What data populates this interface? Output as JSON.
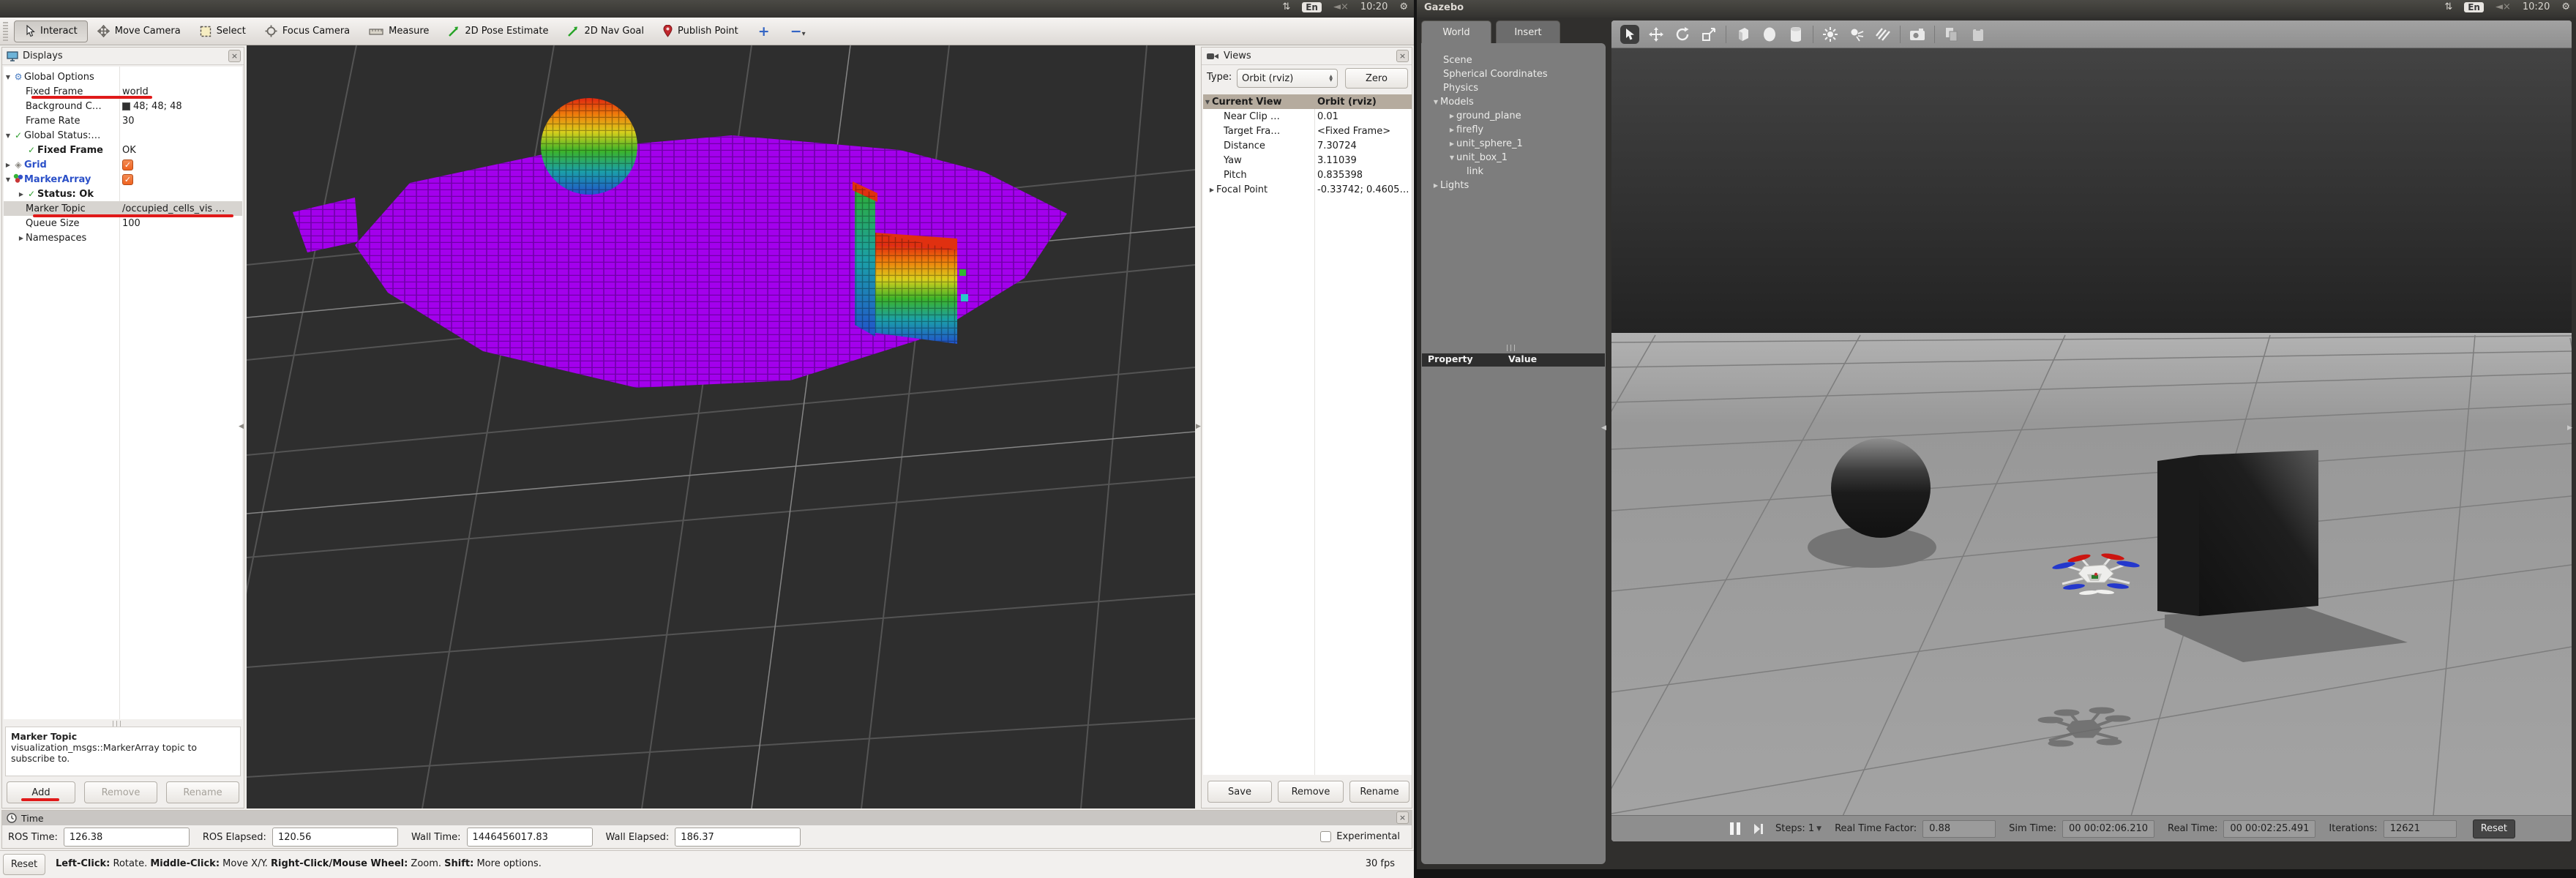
{
  "colors": {
    "annotation": "#e01a1a",
    "rviz_bg": "#2e2e2e",
    "octomap_floor": "#a300ec",
    "checkbox_checked": "#ef6321",
    "display_enabled": "#2b50c8",
    "view_header": "#b5ab9e"
  },
  "indicators": {
    "keyboard": "En",
    "clock": "10:20",
    "mute": "×"
  },
  "rviz": {
    "toolbar": {
      "tools": [
        {
          "label": "Interact"
        },
        {
          "label": "Move Camera"
        },
        {
          "label": "Select"
        },
        {
          "label": "Focus Camera"
        },
        {
          "label": "Measure"
        },
        {
          "label": "2D Pose Estimate"
        },
        {
          "label": "2D Nav Goal"
        },
        {
          "label": "Publish Point"
        }
      ],
      "plus": "+",
      "minus": "−",
      "minus_arrow": "▾"
    },
    "displays": {
      "title": "Displays",
      "rows": [
        {
          "exp": "▼",
          "label": "Global Options",
          "value": ""
        },
        {
          "exp": "",
          "label": "Fixed Frame",
          "value": "world"
        },
        {
          "exp": "",
          "label": "Background C…",
          "value": "48; 48; 48"
        },
        {
          "exp": "",
          "label": "Frame Rate",
          "value": "30"
        },
        {
          "exp": "▼",
          "label": "Global Status:…",
          "value": ""
        },
        {
          "exp": "",
          "label": "Fixed Frame",
          "value": "OK"
        },
        {
          "exp": "▶",
          "label": "Grid",
          "value": ""
        },
        {
          "exp": "▼",
          "label": "MarkerArray",
          "value": ""
        },
        {
          "exp": "▶",
          "label": "Status: Ok",
          "value": ""
        },
        {
          "exp": "",
          "label": "Marker Topic",
          "value": "/occupied_cells_vis …"
        },
        {
          "exp": "",
          "label": "Queue Size",
          "value": "100"
        },
        {
          "exp": "▶",
          "label": "Namespaces",
          "value": ""
        }
      ],
      "help_title": "Marker Topic",
      "help_line1": "visualization_msgs::MarkerArray topic to",
      "help_line2": "subscribe to.",
      "buttons": {
        "add": "Add",
        "remove": "Remove",
        "rename": "Rename"
      }
    },
    "views": {
      "title": "Views",
      "type_label": "Type:",
      "type_value": "Orbit (rviz)",
      "zero": "Zero",
      "rows": [
        {
          "exp": "▼",
          "label": "Current View",
          "value": "Orbit (rviz)"
        },
        {
          "exp": "",
          "label": "Near Clip …",
          "value": "0.01"
        },
        {
          "exp": "",
          "label": "Target Fra…",
          "value": "<Fixed Frame>"
        },
        {
          "exp": "",
          "label": "Distance",
          "value": "7.30724"
        },
        {
          "exp": "",
          "label": "Yaw",
          "value": "3.11039"
        },
        {
          "exp": "",
          "label": "Pitch",
          "value": "0.835398"
        },
        {
          "exp": "▶",
          "label": "Focal Point",
          "value": "-0.33742; 0.4605…"
        }
      ],
      "buttons": {
        "save": "Save",
        "remove": "Remove",
        "rename": "Rename"
      }
    },
    "time_panel": {
      "title": "Time",
      "fields": [
        {
          "label": "ROS Time:",
          "value": "126.38"
        },
        {
          "label": "ROS Elapsed:",
          "value": "120.56"
        },
        {
          "label": "Wall Time:",
          "value": "1446456017.83"
        },
        {
          "label": "Wall Elapsed:",
          "value": "186.37"
        }
      ],
      "experimental": "Experimental"
    },
    "statusbar": {
      "reset": "Reset",
      "help": [
        {
          "k": "Left-Click:",
          "v": " Rotate. "
        },
        {
          "k": "Middle-Click:",
          "v": " Move X/Y. "
        },
        {
          "k": "Right-Click/Mouse Wheel:",
          "v": " Zoom. "
        },
        {
          "k": "Shift:",
          "v": " More options."
        }
      ],
      "fps": "30 fps"
    }
  },
  "gazebo": {
    "window_title": "Gazebo",
    "tabs": {
      "world": "World",
      "insert": "Insert"
    },
    "world_tree": [
      {
        "exp": "",
        "label": "Scene"
      },
      {
        "exp": "",
        "label": "Spherical Coordinates"
      },
      {
        "exp": "",
        "label": "Physics"
      },
      {
        "exp": "▼",
        "label": "Models"
      },
      {
        "exp": "▶",
        "label": "ground_plane"
      },
      {
        "exp": "▶",
        "label": "firefly"
      },
      {
        "exp": "▶",
        "label": "unit_sphere_1"
      },
      {
        "exp": "▼",
        "label": "unit_box_1"
      },
      {
        "exp": "",
        "label": "link"
      },
      {
        "exp": "▶",
        "label": "Lights"
      }
    ],
    "property_header": {
      "property": "Property",
      "value": "Value"
    },
    "statusbar": {
      "steps_label": "Steps: 1",
      "rtf_label": "Real Time Factor:",
      "rtf_value": "0.88",
      "sim_label": "Sim Time:",
      "sim_value": "00 00:02:06.210",
      "real_label": "Real Time:",
      "real_value": "00 00:02:25.491",
      "iter_label": "Iterations:",
      "iter_value": "12621",
      "reset": "Reset"
    }
  }
}
